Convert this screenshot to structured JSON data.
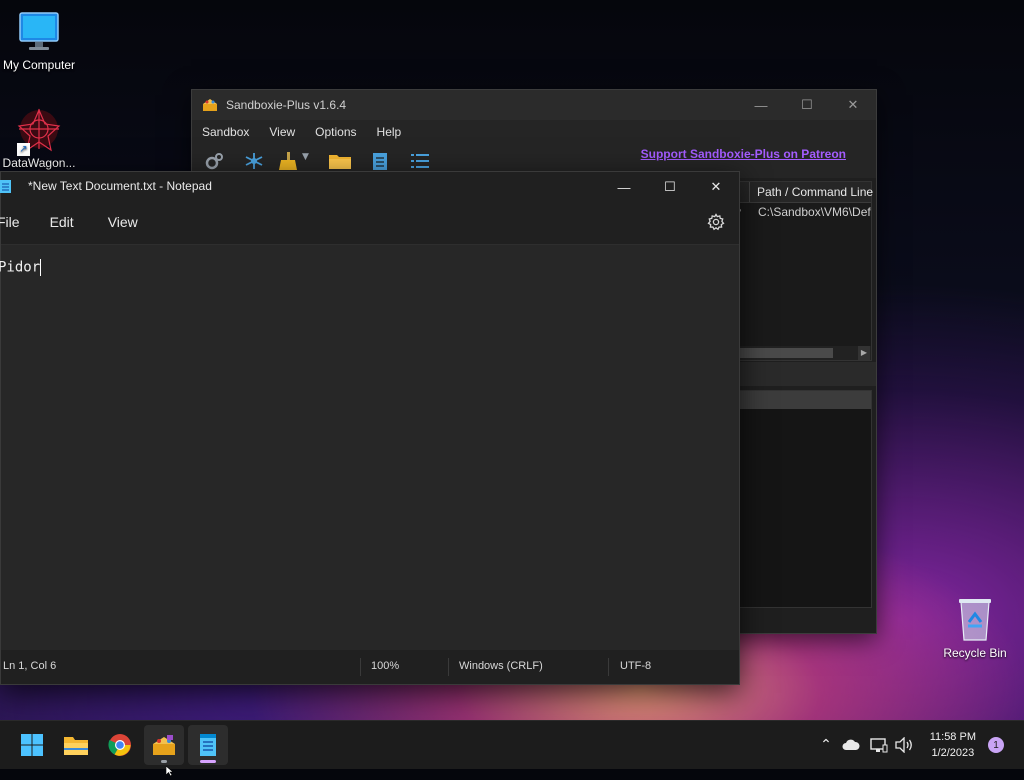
{
  "desktop": {
    "icons": [
      {
        "label": "My Computer"
      },
      {
        "label": "DataWagon..."
      },
      {
        "label": "Recycle Bin"
      }
    ]
  },
  "sandboxie": {
    "title": "Sandboxie-Plus v1.6.4",
    "menu": [
      "Sandbox",
      "View",
      "Options",
      "Help"
    ],
    "patreon_link": "Support Sandboxie-Plus on Patreon",
    "columns": {
      "path_header": "Path / Command Line"
    },
    "row": {
      "partial_col": "y",
      "path": "C:\\Sandbox\\VM6\\Def"
    }
  },
  "notepad": {
    "title": "*New Text Document.txt - Notepad",
    "menu": [
      "File",
      "Edit",
      "View"
    ],
    "content": "Pidor",
    "status": {
      "position": "Ln 1, Col 6",
      "zoom": "100%",
      "line_endings": "Windows (CRLF)",
      "encoding": "UTF-8"
    }
  },
  "taskbar": {
    "apps": [
      "start-icon",
      "file-explorer-icon",
      "chrome-icon",
      "sandboxie-icon",
      "notepad-icon"
    ],
    "clock": {
      "time": "11:58 PM",
      "date": "1/2/2023"
    },
    "notification_count": "1"
  },
  "colors": {
    "accent": "#a45cff",
    "notepad_bg": "#202020",
    "taskbar_bg": "#1c1c1c"
  }
}
